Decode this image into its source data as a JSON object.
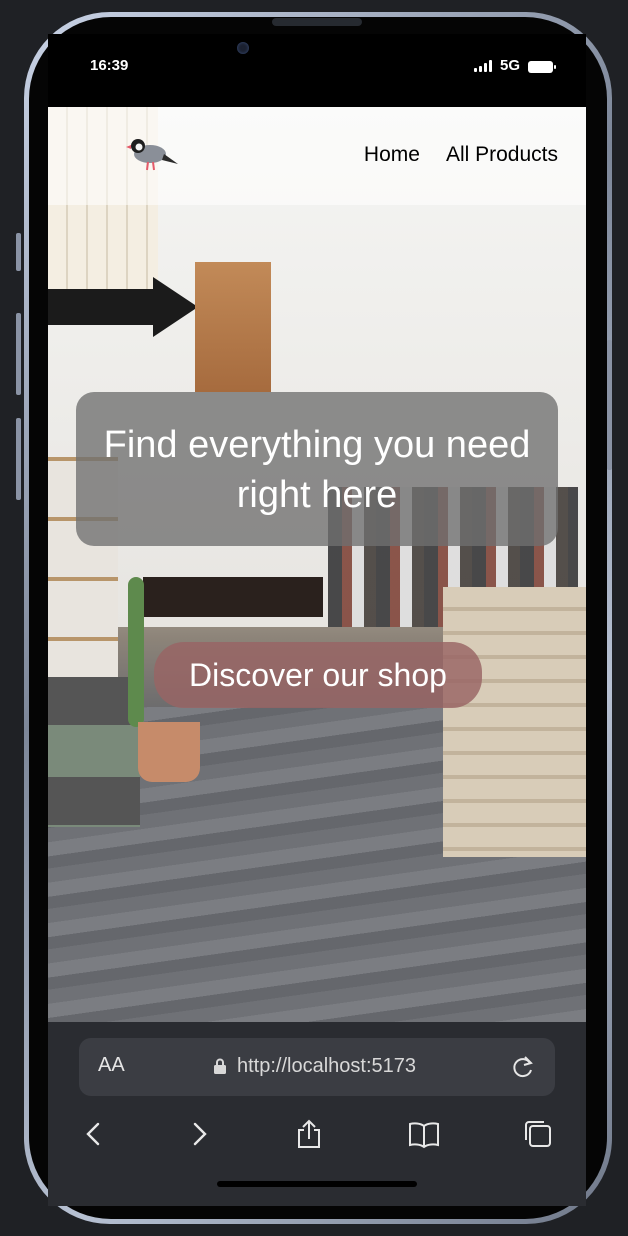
{
  "status_bar": {
    "time": "16:39",
    "network": "5G"
  },
  "nav": {
    "links": [
      "Home",
      "All Products"
    ]
  },
  "hero": {
    "title": "Find everything you need right here",
    "cta_label": "Discover our shop"
  },
  "browser": {
    "text_size_label": "AA",
    "url": "http://localhost:5173"
  },
  "icons": [
    "bird-logo-icon",
    "lock-icon",
    "reload-icon",
    "back-icon",
    "forward-icon",
    "share-icon",
    "bookmarks-icon",
    "tabs-icon"
  ],
  "colors": {
    "cta_background": "#996464",
    "hero_card_background": "#707070",
    "browser_chrome": "#2a2c31"
  }
}
